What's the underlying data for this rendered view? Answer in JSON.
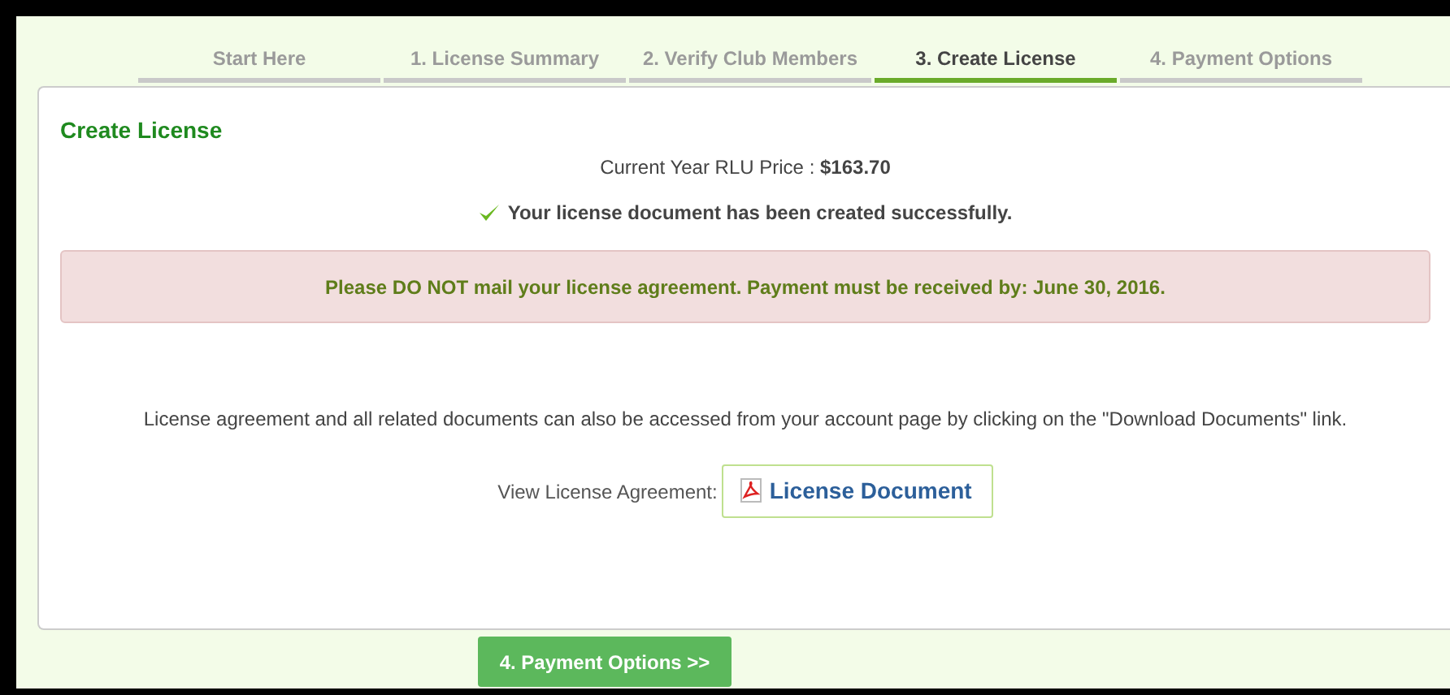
{
  "steps": [
    {
      "label": "Start Here",
      "selected": false
    },
    {
      "label": "1. License Summary",
      "selected": false
    },
    {
      "label": "2. Verify Club Members",
      "selected": false
    },
    {
      "label": "3. Create License",
      "selected": true
    },
    {
      "label": "4. Payment Options",
      "selected": false
    }
  ],
  "panel": {
    "title": "Create License",
    "price_label": "Current Year RLU Price : ",
    "price": "$163.70",
    "success": "Your license document has been created successfully.",
    "alert": "Please DO NOT mail your license agreement. Payment must be received by: June 30, 2016.",
    "info": "License agreement and all related documents can also be accessed from your account page by clicking on the \"Download Documents\" link.",
    "view_label": "View License Agreement:",
    "document_button": "License Document"
  },
  "next_button": "4. Payment Options >>"
}
